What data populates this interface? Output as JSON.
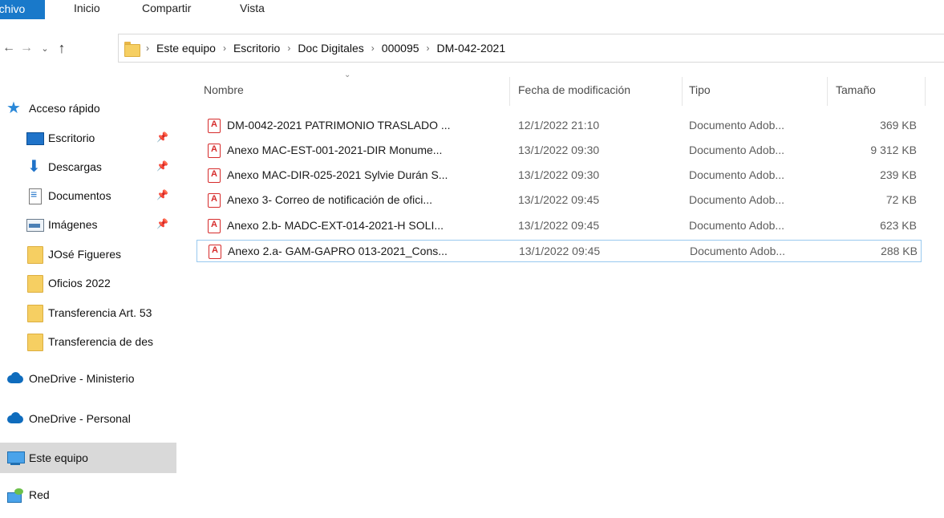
{
  "ribbon": {
    "tabs": [
      "rchivo",
      "Inicio",
      "Compartir",
      "Vista"
    ]
  },
  "nav": {
    "back_glyph": "←",
    "forward_glyph": "→",
    "recent_glyph": "⌄",
    "up_glyph": "↑"
  },
  "address": {
    "separator": "›",
    "crumbs": [
      "Este equipo",
      "Escritorio",
      "Doc Digitales",
      "000095",
      "DM-042-2021"
    ]
  },
  "sidebar": {
    "quick_access": "Acceso rápido",
    "items": [
      {
        "label": "Escritorio",
        "icon": "desktop-icon",
        "pinned": true
      },
      {
        "label": "Descargas",
        "icon": "download-icon",
        "pinned": true
      },
      {
        "label": "Documentos",
        "icon": "documents-icon",
        "pinned": true
      },
      {
        "label": "Imágenes",
        "icon": "images-icon",
        "pinned": true
      },
      {
        "label": "JOsé Figueres",
        "icon": "folder-icon",
        "pinned": false
      },
      {
        "label": "Oficios 2022",
        "icon": "folder-icon",
        "pinned": false
      },
      {
        "label": "Transferencia Art. 53",
        "icon": "folder-icon",
        "pinned": false
      },
      {
        "label": "Transferencia de des",
        "icon": "folder-icon",
        "pinned": false
      }
    ],
    "onedrive_ministerio": "OneDrive - Ministerio",
    "onedrive_personal": "OneDrive - Personal",
    "this_pc": "Este equipo",
    "network": "Red",
    "pin_glyph": "📌"
  },
  "list": {
    "sort_indicator": "⌄",
    "columns": {
      "name": "Nombre",
      "date": "Fecha de modificación",
      "type": "Tipo",
      "size": "Tamaño"
    },
    "rows": [
      {
        "name": "DM-0042-2021 PATRIMONIO TRASLADO ...",
        "date": "12/1/2022 21:10",
        "type": "Documento Adob...",
        "size": "369 KB"
      },
      {
        "name": "Anexo MAC-EST-001-2021-DIR Monume...",
        "date": "13/1/2022 09:30",
        "type": "Documento Adob...",
        "size": "9 312 KB"
      },
      {
        "name": "Anexo MAC-DIR-025-2021 Sylvie Durán S...",
        "date": "13/1/2022 09:30",
        "type": "Documento Adob...",
        "size": "239 KB"
      },
      {
        "name": "Anexo 3- Correo de notificación de ofici...",
        "date": "13/1/2022 09:45",
        "type": "Documento Adob...",
        "size": "72 KB"
      },
      {
        "name": "Anexo 2.b- MADC-EXT-014-2021-H SOLI...",
        "date": "13/1/2022 09:45",
        "type": "Documento Adob...",
        "size": "623 KB"
      },
      {
        "name": "Anexo 2.a- GAM-GAPRO 013-2021_Cons...",
        "date": "13/1/2022 09:45",
        "type": "Documento Adob...",
        "size": "288 KB"
      }
    ]
  }
}
